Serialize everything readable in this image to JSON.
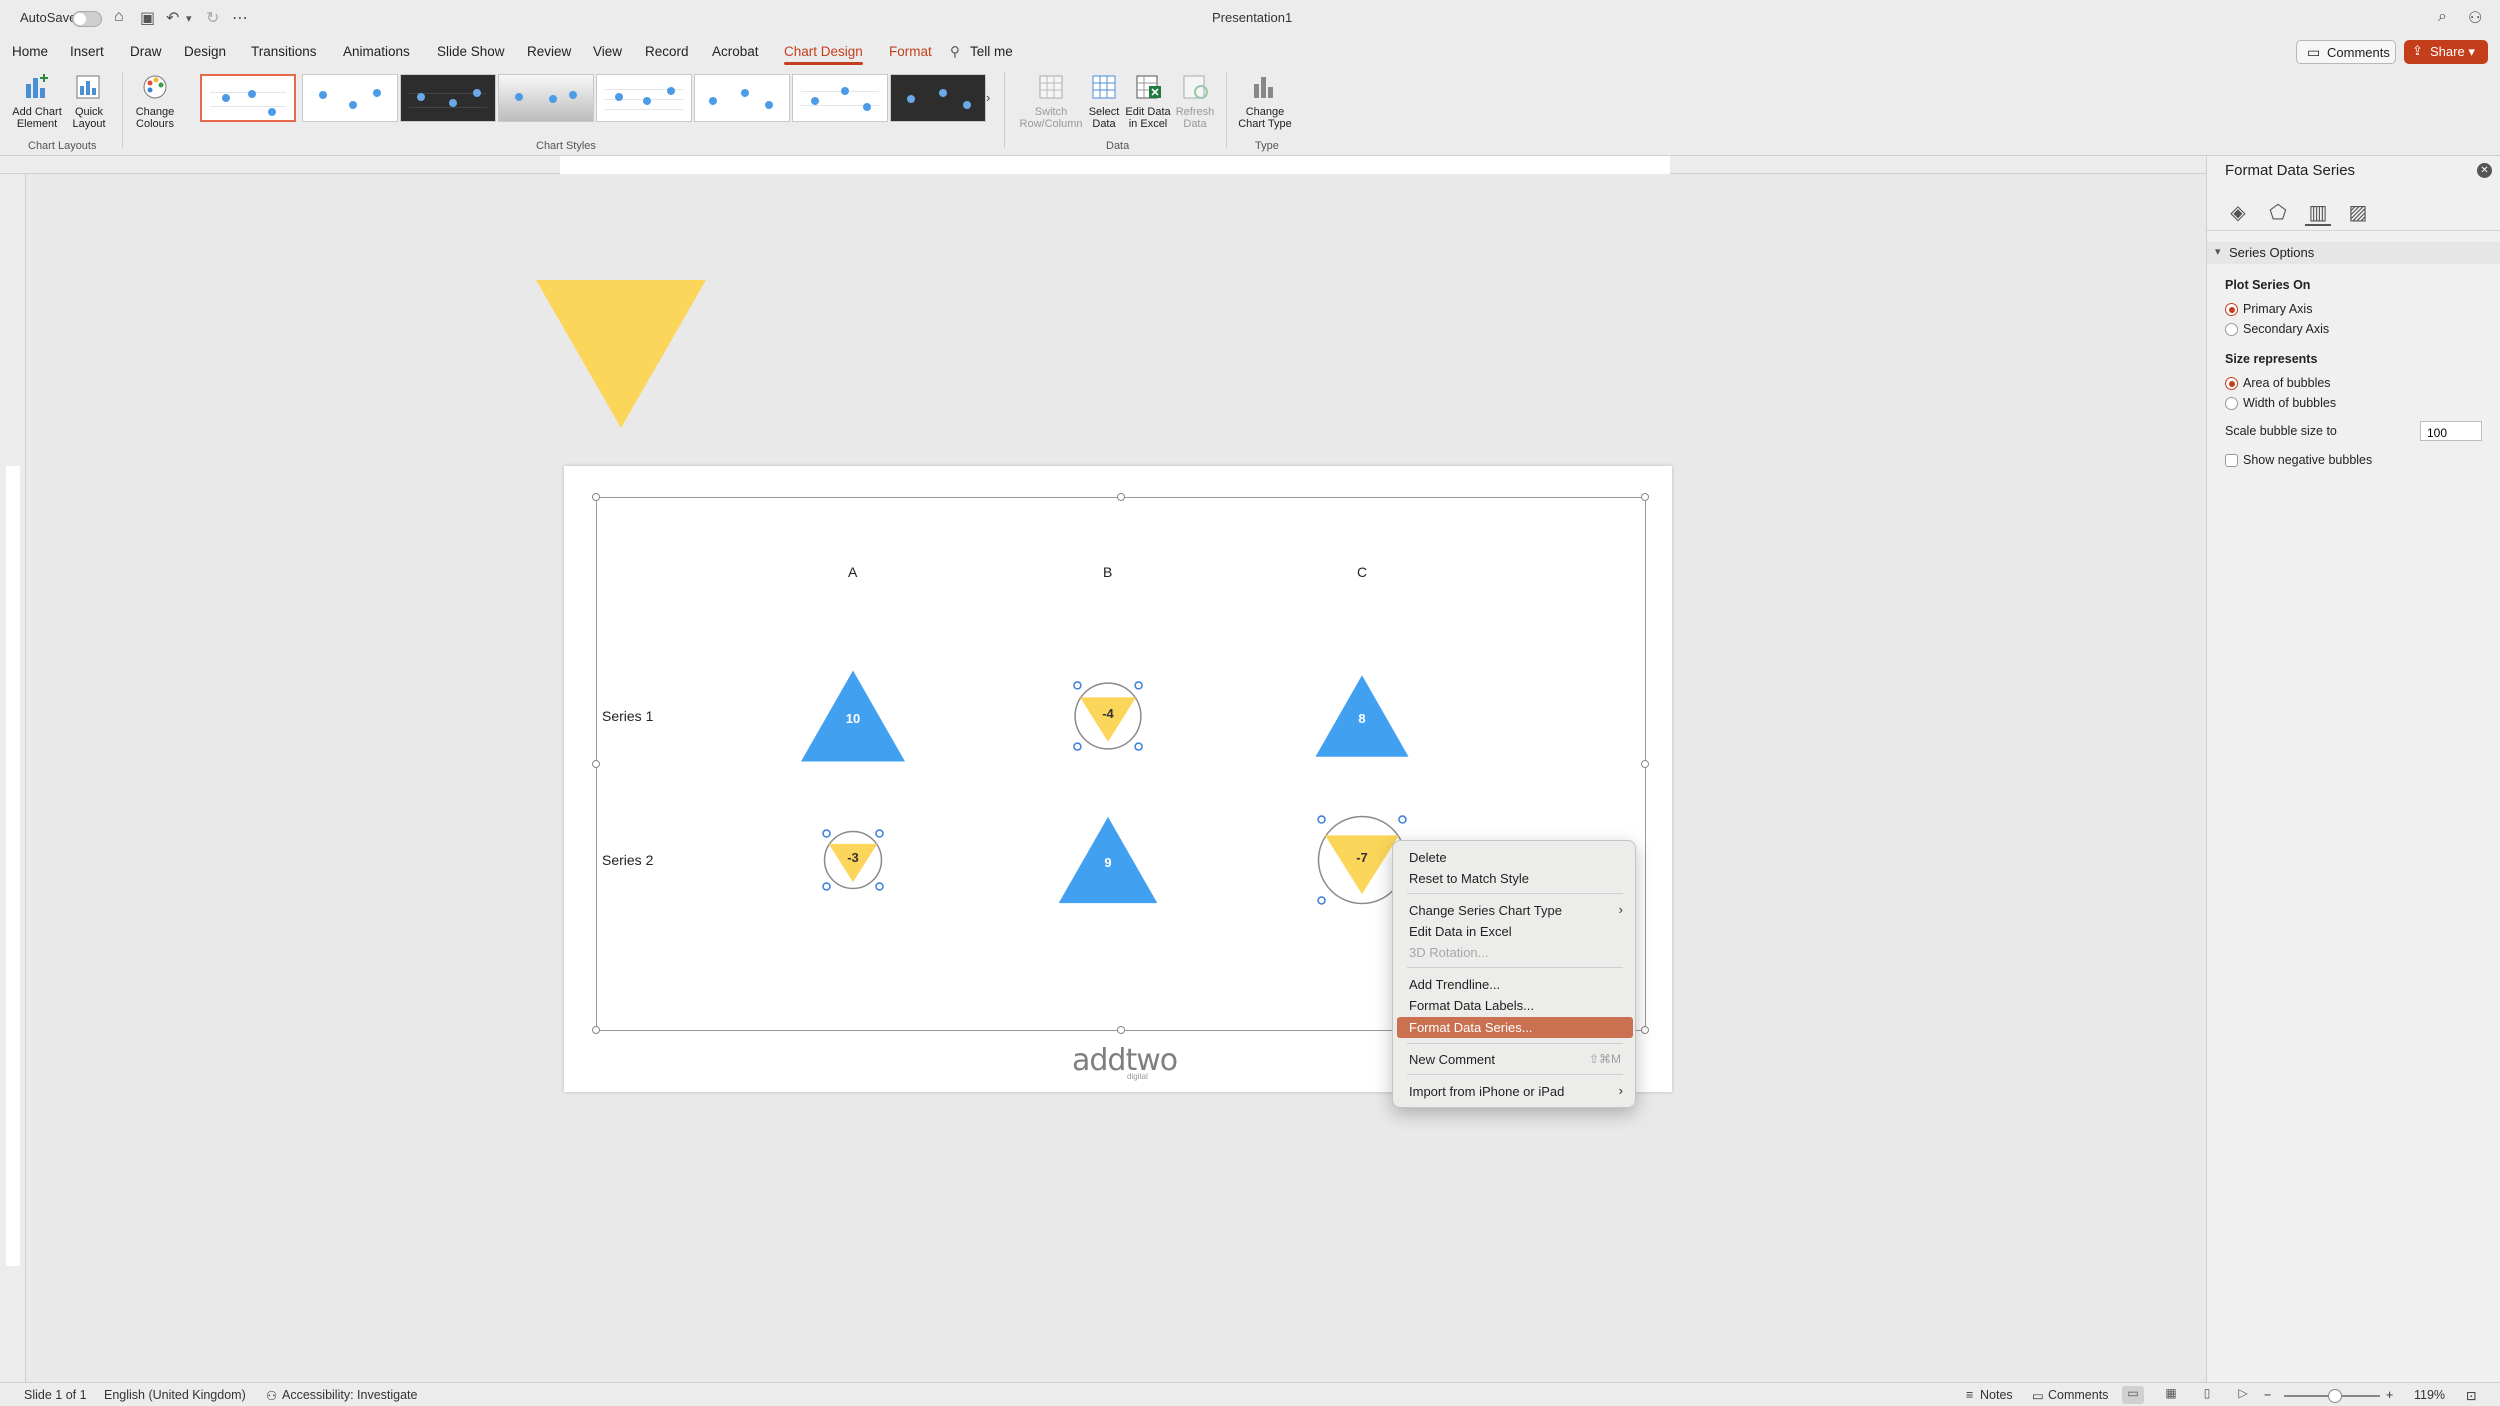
{
  "titlebar": {
    "autosave_label": "AutoSave",
    "document_title": "Presentation1"
  },
  "tabs": [
    "Home",
    "Insert",
    "Draw",
    "Design",
    "Transitions",
    "Animations",
    "Slide Show",
    "Review",
    "View",
    "Record",
    "Acrobat",
    "Chart Design",
    "Format"
  ],
  "active_tab": "Chart Design",
  "tell_me": "Tell me",
  "header_buttons": {
    "comments": "Comments",
    "share": "Share"
  },
  "ribbon": {
    "add_chart_element": "Add Chart Element",
    "quick_layout": "Quick Layout",
    "change_colours": "Change Colours",
    "chart_layouts_label": "Chart Layouts",
    "chart_styles_label": "Chart Styles",
    "switch_row_column": "Switch Row/Column",
    "select_data": "Select Data",
    "edit_data_in_excel": "Edit Data in Excel",
    "refresh_data": "Refresh Data",
    "data_label": "Data",
    "change_chart_type": "Change Chart Type",
    "type_label": "Type"
  },
  "colors": {
    "accent": "#c43e1c",
    "bubble_positive": "#42a0f0",
    "bubble_negative": "#fbd65a",
    "menu_highlight": "#c97150"
  },
  "chart_data": {
    "type": "bubble",
    "categories": [
      "A",
      "B",
      "C"
    ],
    "series": [
      {
        "name": "Series 1",
        "values": [
          10,
          -4,
          8
        ]
      },
      {
        "name": "Series 2",
        "values": [
          -3,
          9,
          -7
        ]
      }
    ],
    "positive_marker": "triangle-up",
    "negative_marker": "triangle-down-in-circle"
  },
  "logo_text": "addtwo",
  "logo_sub": "digital",
  "context_menu": {
    "items": [
      {
        "label": "Delete"
      },
      {
        "label": "Reset to Match Style"
      },
      {
        "label": "Change Series Chart Type",
        "submenu": true
      },
      {
        "label": "Edit Data in Excel"
      },
      {
        "label": "3D Rotation...",
        "disabled": true
      },
      {
        "label": "Add Trendline..."
      },
      {
        "label": "Format Data Labels..."
      },
      {
        "label": "Format Data Series...",
        "highlighted": true
      },
      {
        "label": "New Comment",
        "shortcut": "⇧⌘M"
      },
      {
        "label": "Import from iPhone or iPad",
        "submenu": true
      }
    ]
  },
  "pane": {
    "title": "Format Data Series",
    "section": "Series Options",
    "plot_series_on": "Plot Series On",
    "primary_axis": "Primary Axis",
    "secondary_axis": "Secondary Axis",
    "size_represents": "Size represents",
    "area_of_bubbles": "Area of bubbles",
    "width_of_bubbles": "Width of bubbles",
    "scale_label": "Scale bubble size to",
    "scale_value": "100",
    "show_negative": "Show negative bubbles"
  },
  "statusbar": {
    "slide": "Slide 1 of 1",
    "language": "English (United Kingdom)",
    "accessibility": "Accessibility: Investigate",
    "notes": "Notes",
    "comments": "Comments",
    "zoom": "119%"
  }
}
